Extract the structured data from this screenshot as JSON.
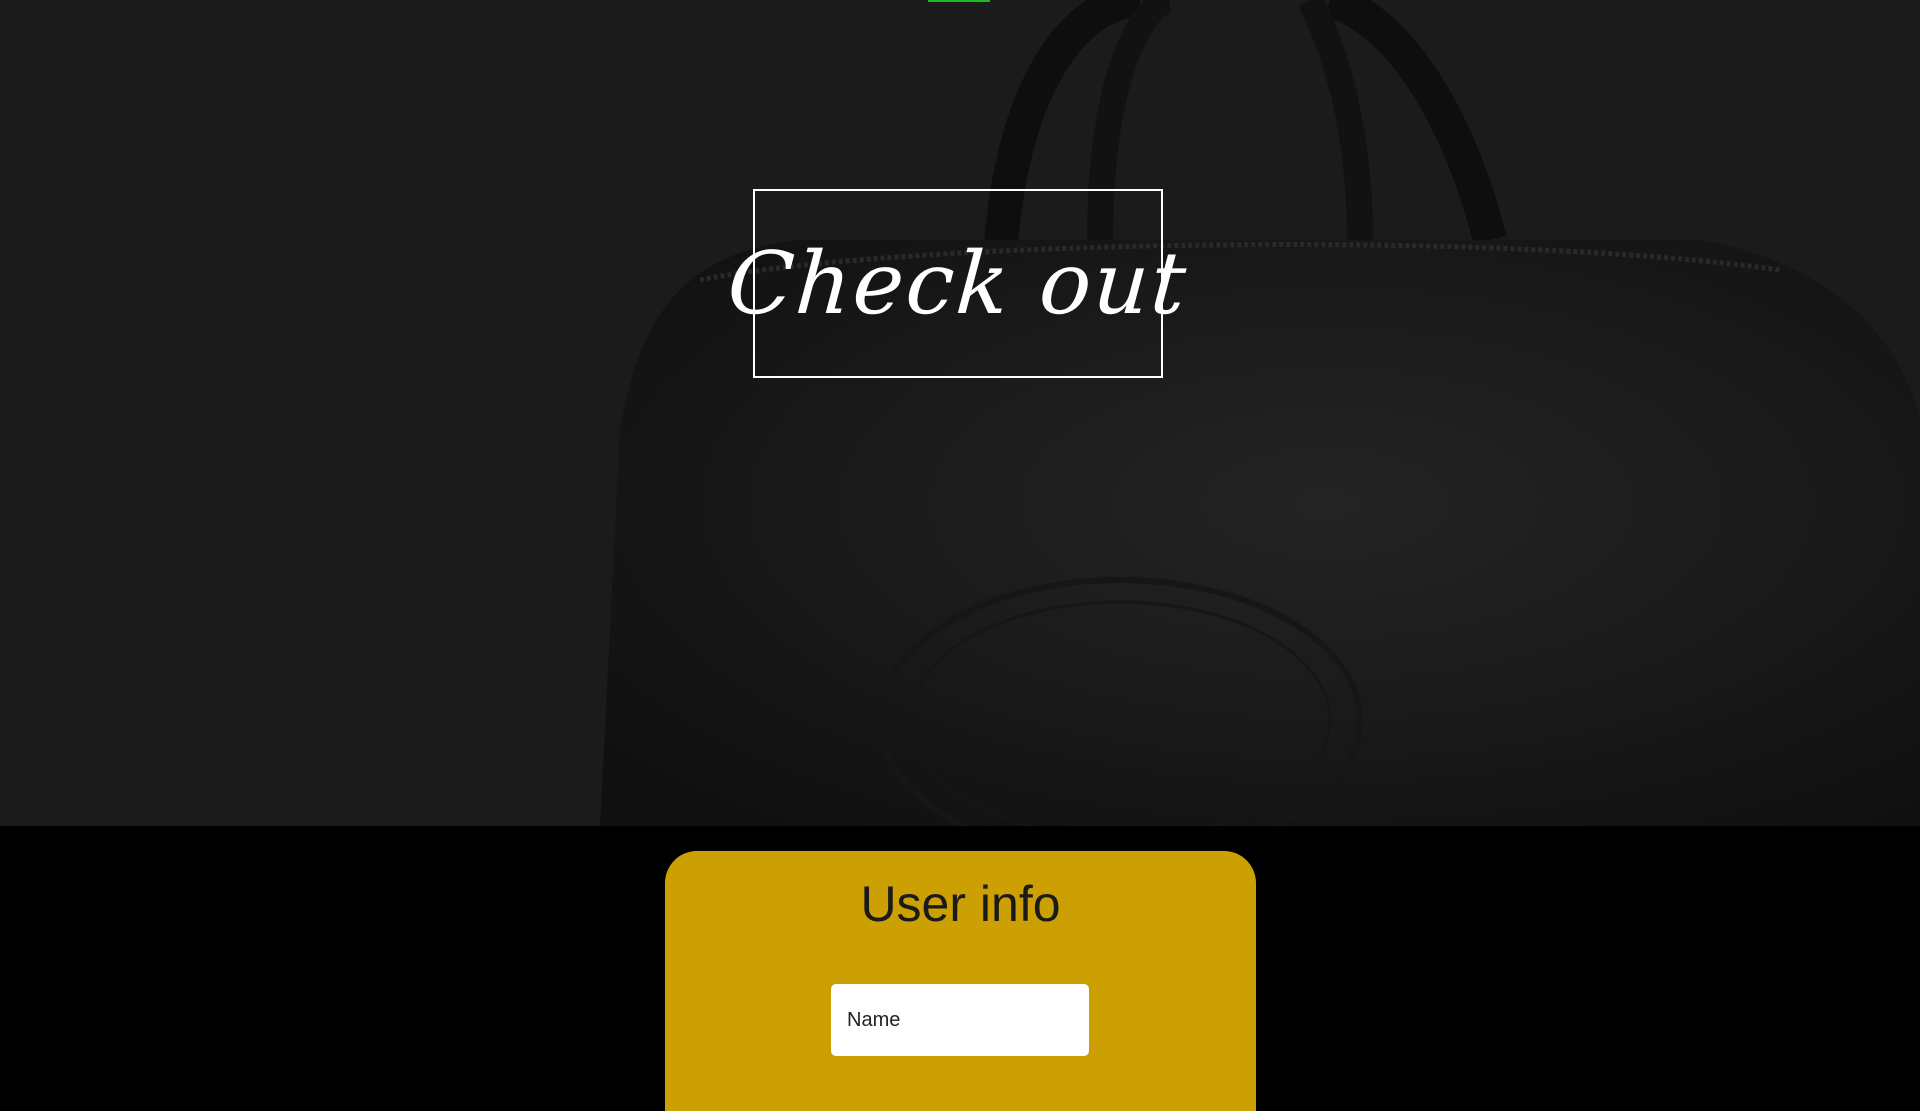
{
  "hero": {
    "title": "Check out",
    "image_description_icon": "leather-bag-image",
    "nav_indicator_color": "#1fb81f"
  },
  "user_info": {
    "title": "User info",
    "name_field": {
      "placeholder": "Name",
      "value": ""
    }
  },
  "colors": {
    "hero_background": "#1b1b1b",
    "page_background": "#000000",
    "panel_background": "#cc9f02",
    "title_text": "#ffffff"
  }
}
